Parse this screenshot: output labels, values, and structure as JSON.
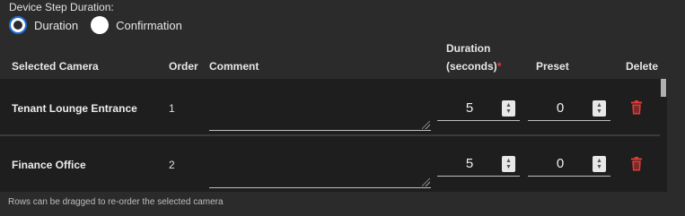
{
  "step_duration": {
    "title": "Device Step Duration:",
    "options": [
      {
        "label": "Duration",
        "selected": true
      },
      {
        "label": "Confirmation",
        "selected": false
      }
    ]
  },
  "table": {
    "headers": {
      "camera": "Selected Camera",
      "order": "Order",
      "comment": "Comment",
      "duration_line1": "Duration",
      "duration_line2": "(seconds)",
      "required_mark": "*",
      "preset": "Preset",
      "delete": "Delete"
    },
    "rows": [
      {
        "camera": "Tenant Lounge Entrance",
        "order": "1",
        "comment": "",
        "duration": "5",
        "preset": "0"
      },
      {
        "camera": "Finance Office",
        "order": "2",
        "comment": "",
        "duration": "5",
        "preset": "0"
      }
    ]
  },
  "footer_note": "Rows can be dragged to re-order the selected camera",
  "colors": {
    "background": "#2b2b2b",
    "row_background": "#1e1e1e",
    "radio_accent": "#1e6fd9",
    "delete_icon": "#e53935",
    "required": "#e53935"
  },
  "icons": {
    "delete": "trash-icon",
    "spinner_up": "chevron-up-icon",
    "spinner_down": "chevron-down-icon",
    "resize": "resize-grip-icon"
  }
}
